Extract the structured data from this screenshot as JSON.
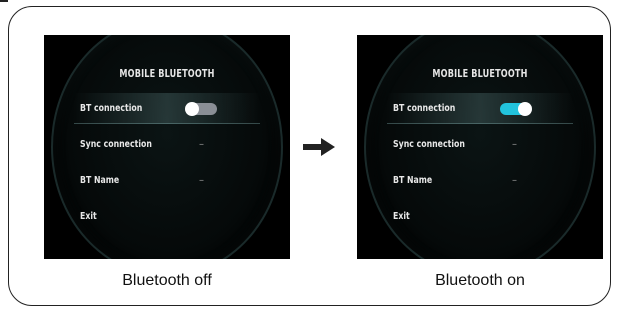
{
  "left_screen": {
    "title": "MOBILE BLUETOOTH",
    "rows": [
      {
        "label": "BT connection",
        "value": ""
      },
      {
        "label": "Sync connection",
        "value": "–"
      },
      {
        "label": "BT Name",
        "value": "–"
      },
      {
        "label": "Exit",
        "value": ""
      }
    ],
    "toggle_state": "off",
    "caption": "Bluetooth off"
  },
  "right_screen": {
    "title": "MOBILE BLUETOOTH",
    "rows": [
      {
        "label": "BT connection",
        "value": ""
      },
      {
        "label": "Sync connection",
        "value": "–"
      },
      {
        "label": "BT Name",
        "value": "–"
      },
      {
        "label": "Exit",
        "value": ""
      }
    ],
    "toggle_state": "on",
    "caption": "Bluetooth on"
  },
  "colors": {
    "toggle_on": "#22c3dd",
    "toggle_off": "#8a8f96",
    "screen_bg": "#000000"
  },
  "icons": {
    "transition": "arrow-right-icon"
  }
}
